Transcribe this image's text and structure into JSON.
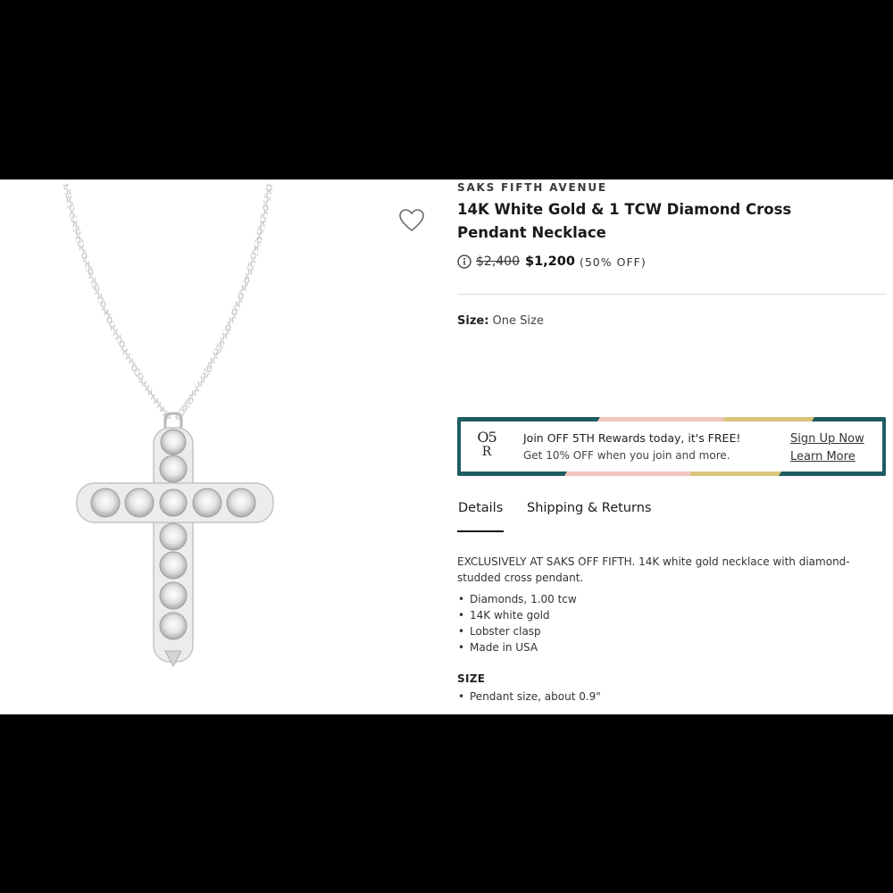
{
  "product": {
    "brand": "SAKS FIFTH AVENUE",
    "title": "14K White Gold & 1 TCW Diamond Cross Pendant Necklace",
    "original_price": "$2,400",
    "sale_price": "$1,200",
    "discount": "(50% OFF)",
    "size_label": "Size:",
    "size_value": "One Size"
  },
  "rewards": {
    "logo_line1": "O5",
    "logo_line2": "R",
    "headline": "Join OFF 5TH Rewards today, it's FREE!",
    "subtext": "Get 10% OFF when you join and more.",
    "sign_up_link": "Sign Up Now",
    "learn_more_link": "Learn More"
  },
  "tabs": [
    {
      "label": "Details",
      "active": true
    },
    {
      "label": "Shipping & Returns",
      "active": false
    }
  ],
  "details": {
    "description": "EXCLUSIVELY AT SAKS OFF FIFTH. 14K white gold necklace with diamond-studded cross pendant.",
    "bullets": [
      "Diamonds, 1.00 tcw",
      "14K white gold",
      "Lobster clasp",
      "Made in USA"
    ],
    "size_heading": "SIZE",
    "size_bullets": [
      "Pendant size, about 0.9\""
    ]
  },
  "icons": {
    "wishlist": "heart-outline-icon",
    "price_info": "info-circle-icon"
  },
  "colors": {
    "page_bg": "#ffffff",
    "letterbox": "#000000",
    "banner_teal": "#1f5c63",
    "banner_gold": "#d9c47a",
    "banner_pink": "#f2c6be"
  }
}
